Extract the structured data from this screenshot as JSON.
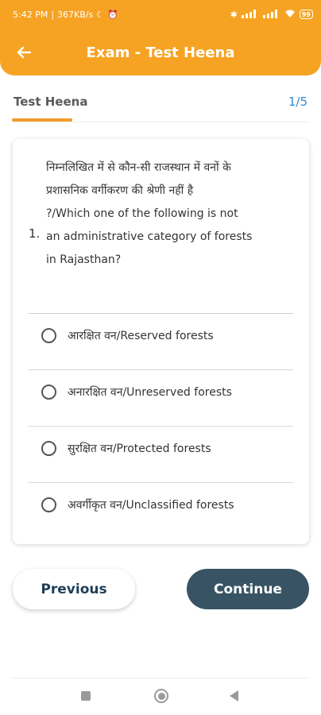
{
  "status_bar": {
    "time": "5:42 PM",
    "net_speed": "367KB/s",
    "battery": "99"
  },
  "app_bar": {
    "title": "Exam - Test Heena"
  },
  "quiz": {
    "name": "Test Heena",
    "counter": "1/5"
  },
  "question": {
    "number": "1.",
    "text_line1": "निम्नलिखित में से कौन-सी राजस्थान में वनों के",
    "text_line2": "प्रशासनिक वर्गीकरण की श्रेणी नहीं है",
    "text_line3": "?/Which one of the following is not",
    "text_line4": "an administrative category of forests",
    "text_line5": "in Rajasthan?",
    "options": [
      {
        "label": "आरक्षित वन/Reserved forests"
      },
      {
        "label": "अनारक्षित वन/Unreserved forests"
      },
      {
        "label": "सुरक्षित वन/Protected forests"
      },
      {
        "label": "अवर्गीकृत वन/Unclassified forests"
      }
    ]
  },
  "buttons": {
    "previous": "Previous",
    "continue": "Continue"
  },
  "colors": {
    "header": "#f6a323",
    "accent_underline": "#f29b2a",
    "counter": "#2f8ad3",
    "continue_button": "#385464"
  },
  "icons": {
    "back": "arrow-left-icon",
    "nav_recents": "square-icon",
    "nav_home": "circle-icon",
    "nav_back": "triangle-back-icon"
  }
}
